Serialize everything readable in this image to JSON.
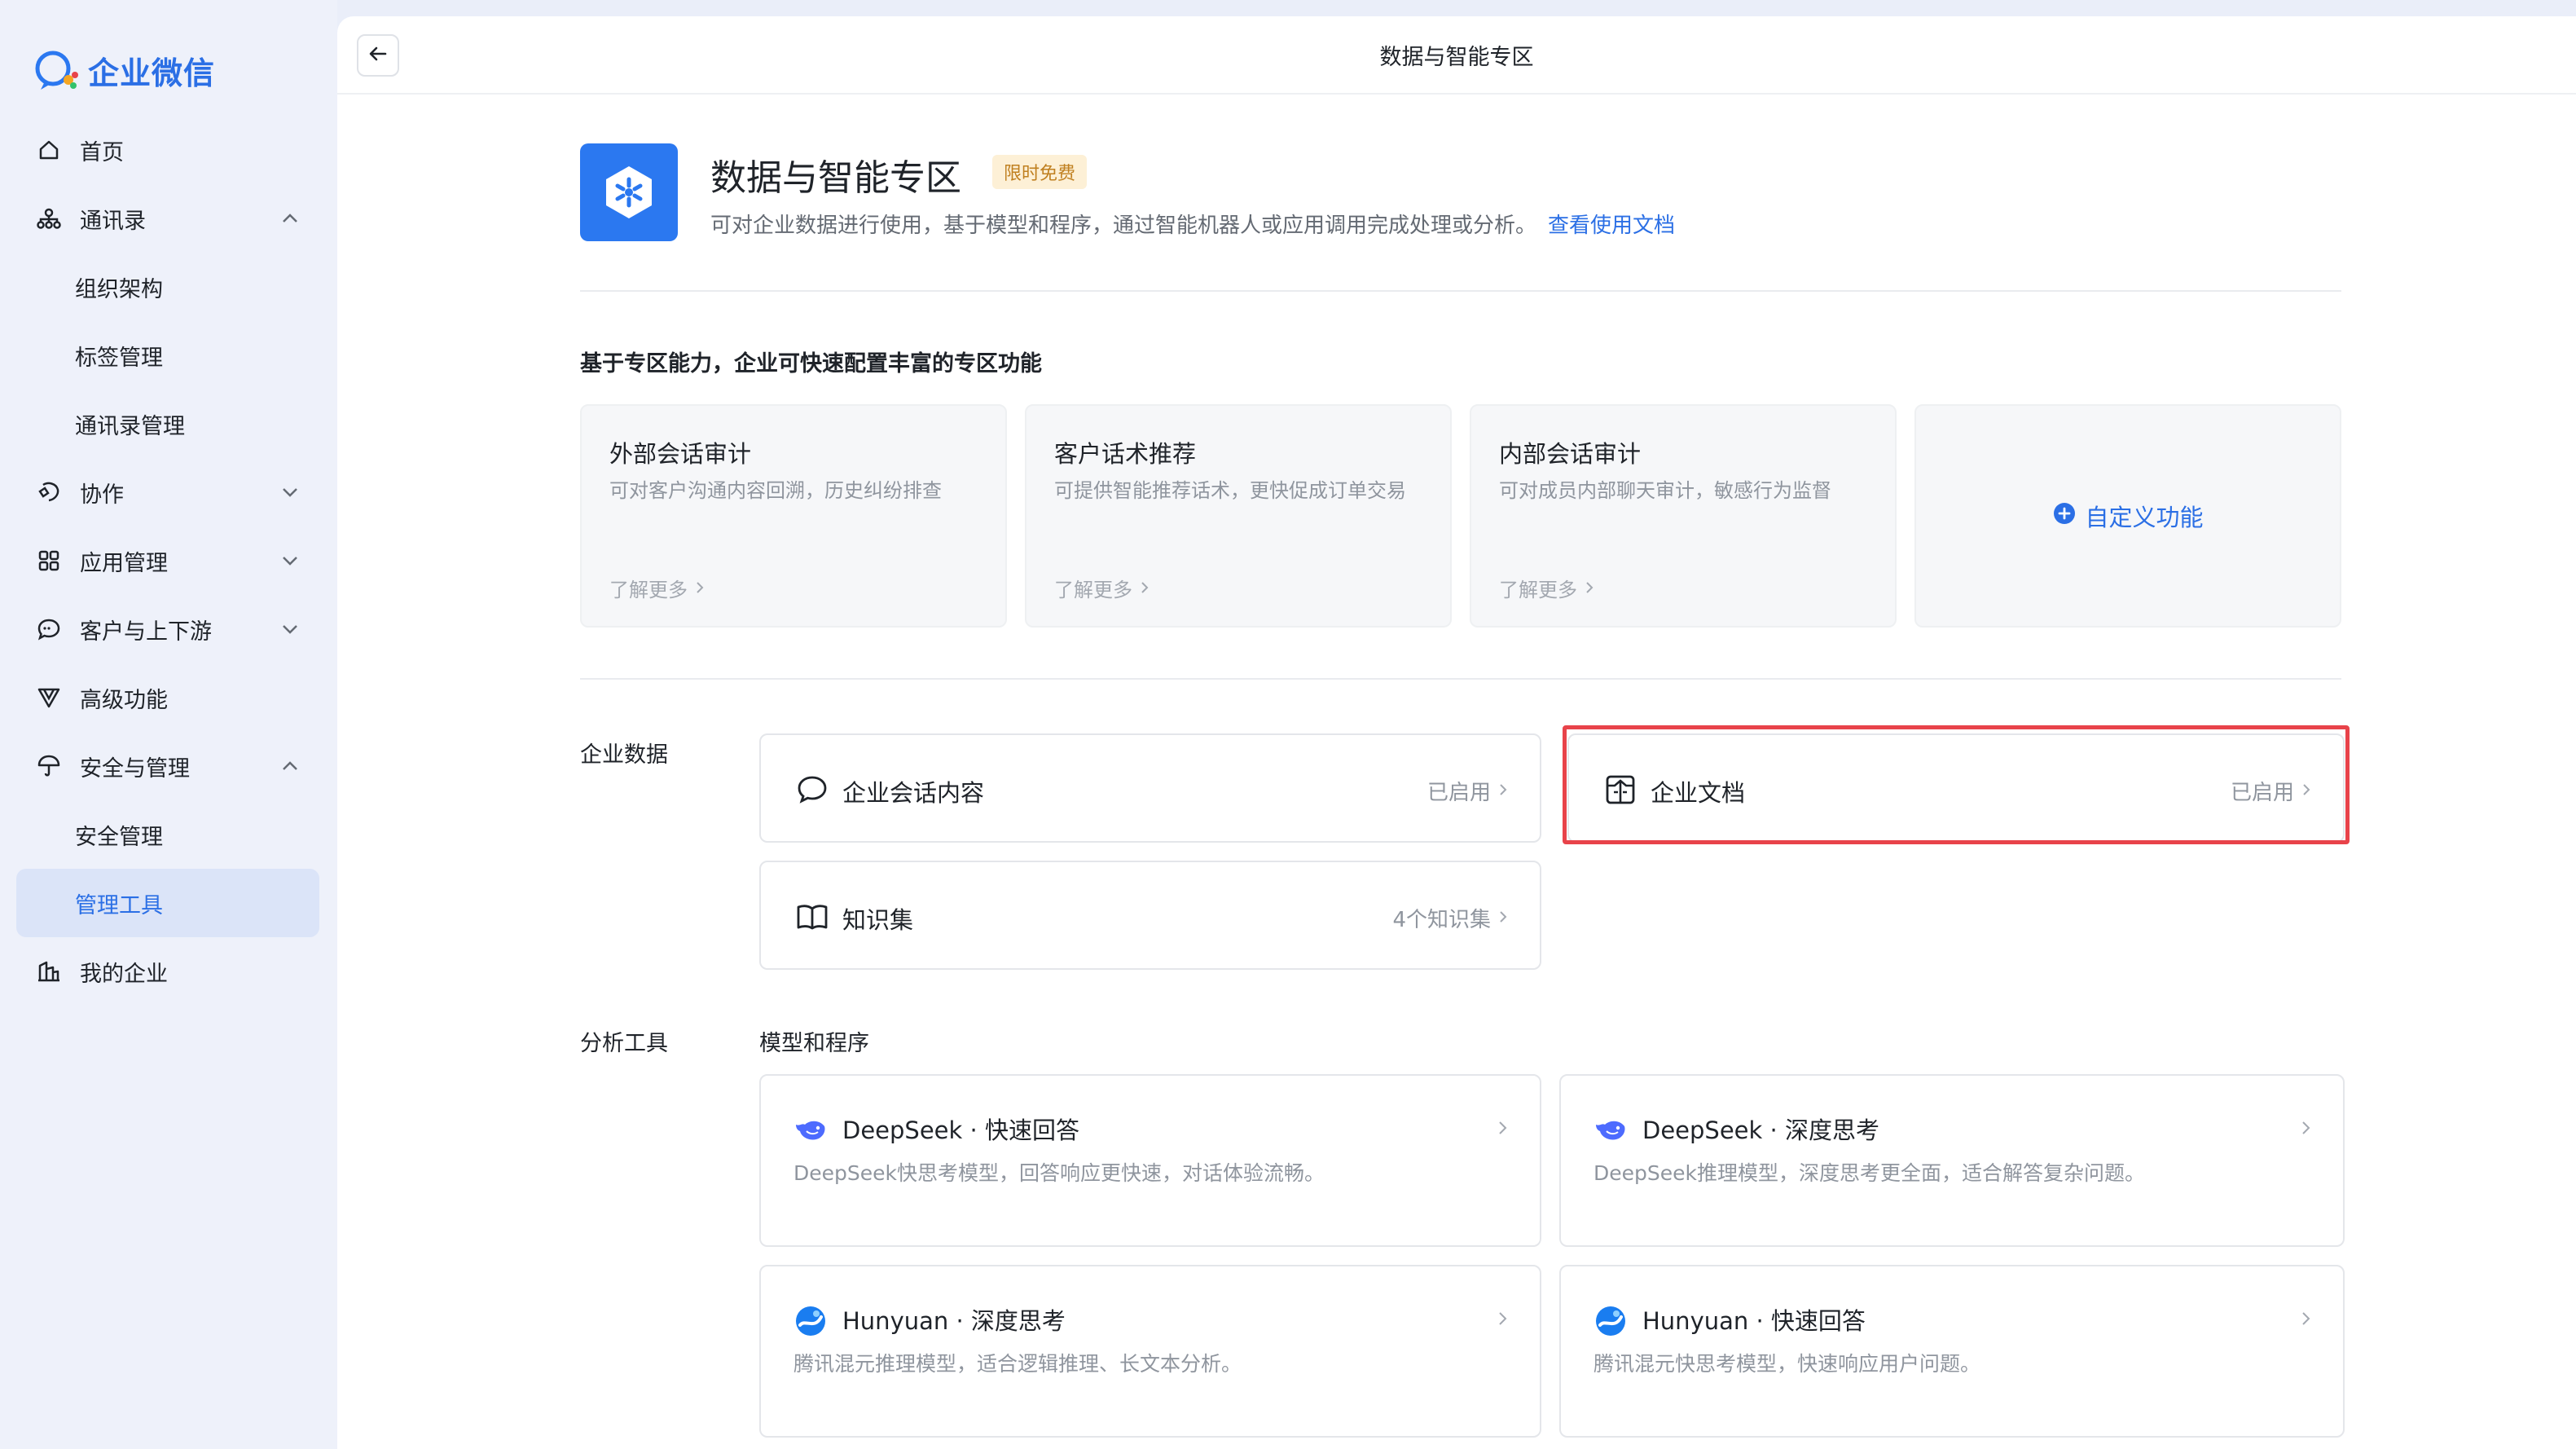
{
  "app": {
    "name": "企业微信"
  },
  "sidebar": {
    "items": [
      {
        "label": "首页",
        "icon": "home-icon"
      },
      {
        "label": "通讯录",
        "icon": "org-icon",
        "expanded": true
      },
      {
        "label": "组织架构",
        "sub": true
      },
      {
        "label": "标签管理",
        "sub": true
      },
      {
        "label": "通讯录管理",
        "sub": true
      },
      {
        "label": "协作",
        "icon": "collab-icon",
        "expanded": false
      },
      {
        "label": "应用管理",
        "icon": "grid-icon",
        "expanded": false
      },
      {
        "label": "客户与上下游",
        "icon": "chat-icon",
        "expanded": false
      },
      {
        "label": "高级功能",
        "icon": "filter-icon"
      },
      {
        "label": "安全与管理",
        "icon": "umbrella-icon",
        "expanded": true
      },
      {
        "label": "安全管理",
        "sub": true
      },
      {
        "label": "管理工具",
        "sub": true,
        "active": true
      },
      {
        "label": "我的企业",
        "icon": "building-icon"
      }
    ]
  },
  "topbar": {
    "title": "数据与智能专区"
  },
  "header": {
    "title": "数据与智能专区",
    "badge": "限时免费",
    "description": "可对企业数据进行使用，基于模型和程序，通过智能机器人或应用调用完成处理或分析。",
    "doc_link": "查看使用文档"
  },
  "features": {
    "heading": "基于专区能力，企业可快速配置丰富的专区功能",
    "cards": [
      {
        "title": "外部会话审计",
        "desc": "可对客户沟通内容回溯，历史纠纷排查",
        "more": "了解更多"
      },
      {
        "title": "客户话术推荐",
        "desc": "可提供智能推荐话术，更快促成订单交易",
        "more": "了解更多"
      },
      {
        "title": "内部会话审计",
        "desc": "可对成员内部聊天审计，敏感行为监督",
        "more": "了解更多"
      }
    ],
    "custom": "自定义功能"
  },
  "enterprise_data": {
    "label": "企业数据",
    "items": [
      {
        "label": "企业会话内容",
        "status": "已启用",
        "icon": "chat-bubble-icon"
      },
      {
        "label": "企业文档",
        "status": "已启用",
        "icon": "document-icon"
      },
      {
        "label": "知识集",
        "status": "4个知识集",
        "icon": "book-icon"
      }
    ]
  },
  "analysis": {
    "label": "分析工具",
    "sublabel": "模型和程序",
    "models": [
      {
        "name": "DeepSeek · 快速回答",
        "desc": "DeepSeek快思考模型，回答响应更快速，对话体验流畅。",
        "icon": "deepseek-icon"
      },
      {
        "name": "DeepSeek · 深度思考",
        "desc": "DeepSeek推理模型，深度思考更全面，适合解答复杂问题。",
        "icon": "deepseek-icon"
      },
      {
        "name": "Hunyuan · 深度思考",
        "desc": "腾讯混元推理模型，适合逻辑推理、长文本分析。",
        "icon": "hunyuan-icon"
      },
      {
        "name": "Hunyuan · 快速回答",
        "desc": "腾讯混元快思考模型，快速响应用户问题。",
        "icon": "hunyuan-icon"
      }
    ]
  },
  "colors": {
    "accent": "#2b6fe5",
    "highlight": "#e8434a"
  }
}
